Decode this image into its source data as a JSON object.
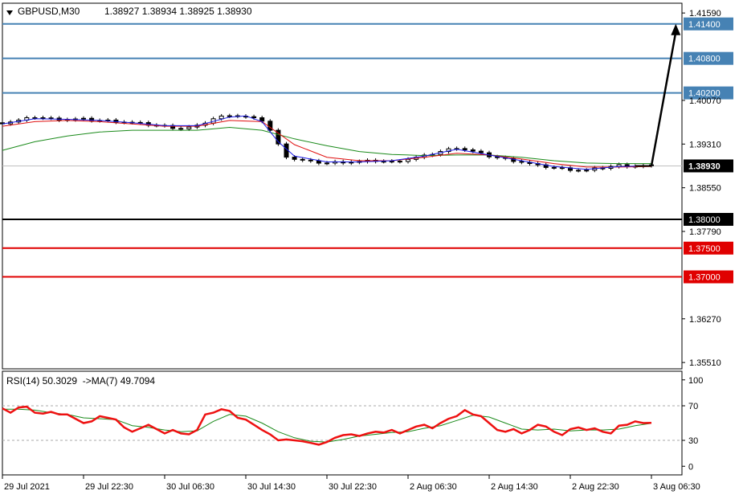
{
  "header": {
    "symbol": "GBPUSD,M30",
    "ohlc": "1.38927 1.38934 1.38925 1.38930"
  },
  "rsi_header": "RSI(14) 50.3029  ->MA(7) 49.7094",
  "colors": {
    "candle": "#000000",
    "ma_fast": "#1a1ae6",
    "ma_mid": "#e01010",
    "ma_slow": "#1a8a1a",
    "resistance": "#4682b4",
    "support": "#e00000",
    "pivot": "#000000",
    "rsi": "#ee1111",
    "rsi_ma": "#1a8a1a",
    "current_price": "#c0c0c0"
  },
  "chart_data": [
    {
      "type": "line",
      "panel": "price",
      "title": "GBPUSD,M30",
      "ylim": [
        1.354,
        1.4176
      ],
      "y_ticks": [
        "1.41590",
        "1.40070",
        "1.39310",
        "1.38550",
        "1.37790",
        "1.36270",
        "1.35510"
      ],
      "x_ticks": [
        "29 Jul 2021",
        "29 Jul 22:30",
        "30 Jul 06:30",
        "30 Jul 14:30",
        "30 Jul 22:30",
        "2 Aug 06:30",
        "2 Aug 14:30",
        "2 Aug 22:30",
        "3 Aug 06:30"
      ],
      "current_price": 1.3893,
      "current_price_label": "1.38930",
      "levels": [
        {
          "value": 1.414,
          "label": "1.41400",
          "kind": "resistance"
        },
        {
          "value": 1.408,
          "label": "1.40800",
          "kind": "resistance"
        },
        {
          "value": 1.402,
          "label": "1.40200",
          "kind": "resistance"
        },
        {
          "value": 1.38,
          "label": "1.38000",
          "kind": "pivot"
        },
        {
          "value": 1.375,
          "label": "1.37500",
          "kind": "support"
        },
        {
          "value": 1.37,
          "label": "1.37000",
          "kind": "support"
        }
      ],
      "close_path": [
        [
          0,
          1.3968
        ],
        [
          2,
          1.3972
        ],
        [
          4,
          1.3978
        ],
        [
          6,
          1.3975
        ],
        [
          8,
          1.3974
        ],
        [
          10,
          1.3974
        ],
        [
          12,
          1.3972
        ],
        [
          14,
          1.3971
        ],
        [
          16,
          1.3968
        ],
        [
          18,
          1.3965
        ],
        [
          20,
          1.3962
        ],
        [
          22,
          1.3958
        ],
        [
          24,
          1.3962
        ],
        [
          26,
          1.3975
        ],
        [
          28,
          1.3982
        ],
        [
          30,
          1.3978
        ],
        [
          32,
          1.3972
        ],
        [
          33,
          1.3955
        ],
        [
          34,
          1.393
        ],
        [
          35,
          1.391
        ],
        [
          36,
          1.3905
        ],
        [
          38,
          1.39
        ],
        [
          40,
          1.3898
        ],
        [
          42,
          1.39
        ],
        [
          44,
          1.39
        ],
        [
          46,
          1.3902
        ],
        [
          48,
          1.39
        ],
        [
          50,
          1.3905
        ],
        [
          52,
          1.391
        ],
        [
          54,
          1.3918
        ],
        [
          56,
          1.3925
        ],
        [
          58,
          1.3918
        ],
        [
          60,
          1.391
        ],
        [
          62,
          1.3905
        ],
        [
          64,
          1.39
        ],
        [
          66,
          1.3893
        ],
        [
          68,
          1.389
        ],
        [
          70,
          1.3887
        ],
        [
          72,
          1.3885
        ],
        [
          74,
          1.389
        ],
        [
          76,
          1.3894
        ],
        [
          78,
          1.3893
        ],
        [
          80,
          1.3893
        ]
      ],
      "ma_fast": [
        [
          0,
          1.3966
        ],
        [
          4,
          1.3975
        ],
        [
          8,
          1.3974
        ],
        [
          12,
          1.3972
        ],
        [
          16,
          1.3968
        ],
        [
          20,
          1.3963
        ],
        [
          24,
          1.3963
        ],
        [
          28,
          1.3978
        ],
        [
          30,
          1.398
        ],
        [
          32,
          1.397
        ],
        [
          34,
          1.3935
        ],
        [
          36,
          1.391
        ],
        [
          40,
          1.39
        ],
        [
          44,
          1.39
        ],
        [
          48,
          1.3902
        ],
        [
          52,
          1.391
        ],
        [
          56,
          1.3922
        ],
        [
          60,
          1.3912
        ],
        [
          64,
          1.3902
        ],
        [
          68,
          1.3892
        ],
        [
          72,
          1.3887
        ],
        [
          76,
          1.3892
        ],
        [
          80,
          1.3893
        ]
      ],
      "ma_mid": [
        [
          0,
          1.3962
        ],
        [
          4,
          1.397
        ],
        [
          8,
          1.3972
        ],
        [
          12,
          1.397
        ],
        [
          16,
          1.3966
        ],
        [
          20,
          1.3962
        ],
        [
          24,
          1.3962
        ],
        [
          28,
          1.3972
        ],
        [
          32,
          1.397
        ],
        [
          36,
          1.393
        ],
        [
          40,
          1.3908
        ],
        [
          44,
          1.3902
        ],
        [
          48,
          1.3902
        ],
        [
          52,
          1.3908
        ],
        [
          56,
          1.3915
        ],
        [
          60,
          1.3912
        ],
        [
          64,
          1.3905
        ],
        [
          68,
          1.3897
        ],
        [
          72,
          1.3891
        ],
        [
          76,
          1.3891
        ],
        [
          80,
          1.3892
        ]
      ],
      "ma_slow": [
        [
          0,
          1.392
        ],
        [
          4,
          1.3935
        ],
        [
          8,
          1.3945
        ],
        [
          12,
          1.3952
        ],
        [
          16,
          1.3955
        ],
        [
          20,
          1.3955
        ],
        [
          24,
          1.3955
        ],
        [
          28,
          1.396
        ],
        [
          32,
          1.3955
        ],
        [
          36,
          1.394
        ],
        [
          40,
          1.3928
        ],
        [
          44,
          1.3918
        ],
        [
          48,
          1.3913
        ],
        [
          52,
          1.3911
        ],
        [
          56,
          1.3912
        ],
        [
          60,
          1.3912
        ],
        [
          64,
          1.3908
        ],
        [
          68,
          1.3902
        ],
        [
          72,
          1.3898
        ],
        [
          76,
          1.3897
        ],
        [
          80,
          1.3897
        ]
      ],
      "projection": {
        "from": [
          80,
          1.3893
        ],
        "to": [
          83,
          1.414
        ]
      }
    },
    {
      "type": "line",
      "panel": "rsi",
      "title": "RSI(14) 50.3029  ->MA(7) 49.7094",
      "ylim": [
        -10,
        110
      ],
      "y_ticks": [
        "100",
        "70",
        "30",
        "0"
      ],
      "levels": [
        70,
        30
      ],
      "rsi": [
        [
          0,
          67
        ],
        [
          1,
          62
        ],
        [
          2,
          68
        ],
        [
          3,
          69
        ],
        [
          4,
          62
        ],
        [
          5,
          61
        ],
        [
          6,
          63
        ],
        [
          7,
          60
        ],
        [
          8,
          60
        ],
        [
          9,
          55
        ],
        [
          10,
          50
        ],
        [
          11,
          52
        ],
        [
          12,
          58
        ],
        [
          13,
          56
        ],
        [
          14,
          54
        ],
        [
          15,
          45
        ],
        [
          16,
          40
        ],
        [
          17,
          44
        ],
        [
          18,
          48
        ],
        [
          19,
          43
        ],
        [
          20,
          38
        ],
        [
          21,
          42
        ],
        [
          22,
          38
        ],
        [
          23,
          37
        ],
        [
          24,
          42
        ],
        [
          25,
          60
        ],
        [
          26,
          62
        ],
        [
          27,
          66
        ],
        [
          28,
          64
        ],
        [
          29,
          56
        ],
        [
          30,
          54
        ],
        [
          31,
          48
        ],
        [
          32,
          42
        ],
        [
          33,
          37
        ],
        [
          34,
          30
        ],
        [
          35,
          31
        ],
        [
          36,
          30
        ],
        [
          37,
          29
        ],
        [
          38,
          27
        ],
        [
          39,
          25
        ],
        [
          40,
          28
        ],
        [
          41,
          33
        ],
        [
          42,
          36
        ],
        [
          43,
          37
        ],
        [
          44,
          35
        ],
        [
          45,
          38
        ],
        [
          46,
          40
        ],
        [
          47,
          39
        ],
        [
          48,
          42
        ],
        [
          49,
          38
        ],
        [
          50,
          42
        ],
        [
          51,
          46
        ],
        [
          52,
          48
        ],
        [
          53,
          44
        ],
        [
          54,
          50
        ],
        [
          55,
          55
        ],
        [
          56,
          58
        ],
        [
          57,
          65
        ],
        [
          58,
          60
        ],
        [
          59,
          58
        ],
        [
          60,
          50
        ],
        [
          61,
          42
        ],
        [
          62,
          40
        ],
        [
          63,
          43
        ],
        [
          64,
          38
        ],
        [
          65,
          42
        ],
        [
          66,
          48
        ],
        [
          67,
          46
        ],
        [
          68,
          40
        ],
        [
          69,
          36
        ],
        [
          70,
          43
        ],
        [
          71,
          45
        ],
        [
          72,
          42
        ],
        [
          73,
          44
        ],
        [
          74,
          40
        ],
        [
          75,
          38
        ],
        [
          76,
          47
        ],
        [
          77,
          48
        ],
        [
          78,
          52
        ],
        [
          79,
          50
        ],
        [
          80,
          50.3
        ]
      ],
      "rsi_ma": [
        [
          0,
          66
        ],
        [
          2,
          66
        ],
        [
          4,
          65
        ],
        [
          6,
          62
        ],
        [
          8,
          60
        ],
        [
          10,
          56
        ],
        [
          12,
          55
        ],
        [
          14,
          54
        ],
        [
          16,
          47
        ],
        [
          18,
          45
        ],
        [
          20,
          42
        ],
        [
          22,
          40
        ],
        [
          24,
          41
        ],
        [
          26,
          52
        ],
        [
          28,
          60
        ],
        [
          30,
          58
        ],
        [
          32,
          50
        ],
        [
          34,
          40
        ],
        [
          36,
          33
        ],
        [
          38,
          29
        ],
        [
          40,
          28
        ],
        [
          42,
          31
        ],
        [
          44,
          35
        ],
        [
          46,
          37
        ],
        [
          48,
          39
        ],
        [
          50,
          40
        ],
        [
          52,
          44
        ],
        [
          54,
          47
        ],
        [
          56,
          53
        ],
        [
          58,
          59
        ],
        [
          60,
          57
        ],
        [
          62,
          50
        ],
        [
          64,
          43
        ],
        [
          66,
          42
        ],
        [
          68,
          43
        ],
        [
          70,
          41
        ],
        [
          72,
          42
        ],
        [
          74,
          42
        ],
        [
          76,
          43
        ],
        [
          78,
          47
        ],
        [
          80,
          49.7
        ]
      ]
    }
  ]
}
